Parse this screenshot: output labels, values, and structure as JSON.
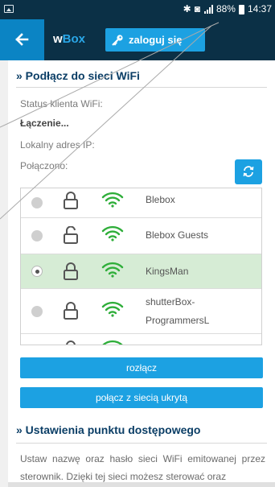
{
  "status_bar": {
    "icons": [
      "image-icon",
      "bluetooth-icon",
      "vibrate-icon",
      "signal-icon",
      "battery-icon"
    ],
    "battery": "88%",
    "time": "14:37"
  },
  "app_bar": {
    "brand_prefix": "w",
    "brand_suffix": "Box",
    "login_label": "zaloguj się",
    "colors": {
      "background": "#0b3046",
      "accent": "#1ca1e2",
      "back_button": "#0b84c4"
    }
  },
  "wifi_section": {
    "title": "» Podłącz do sieci WiFi",
    "status_label": "Status klienta WiFi:",
    "status_value": "Łączenie...",
    "local_ip_label": "Lokalny adres IP:",
    "connected_label": "Połączono:",
    "networks": [
      {
        "ssid": "Blebox",
        "locked": true,
        "selected": false
      },
      {
        "ssid": "Blebox Guests",
        "locked": false,
        "selected": false
      },
      {
        "ssid": "KingsMan",
        "locked": true,
        "selected": true
      },
      {
        "ssid": "shutterBox-ProgrammersL",
        "locked": true,
        "selected": false
      }
    ],
    "disconnect_label": "rozłącz",
    "hidden_network_label": "połącz z siecią ukrytą"
  },
  "ap_section": {
    "title": "» Ustawienia punktu dostępowego",
    "description": "Ustaw nazwę oraz hasło sieci WiFi emitowanej przez sterownik. Dzięki tej sieci możesz sterować oraz"
  }
}
